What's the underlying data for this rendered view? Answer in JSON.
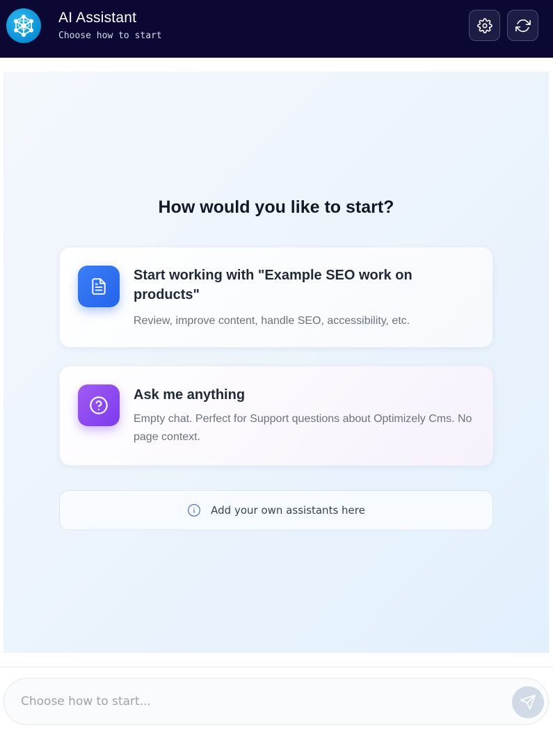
{
  "header": {
    "title": "AI Assistant",
    "subtitle": "Choose how to start",
    "logo_icon": "network-brain-icon",
    "settings_icon": "gear-icon",
    "refresh_icon": "refresh-icon"
  },
  "main": {
    "question": "How would you like to start?",
    "cards": [
      {
        "icon": "document-icon",
        "title": "Start working with \"Example SEO work on products\"",
        "description": "Review, improve content, handle SEO, accessibility, etc."
      },
      {
        "icon": "question-circle-icon",
        "title": "Ask me anything",
        "description": "Empty chat. Perfect for Support questions about Optimizely Cms. No page context."
      }
    ],
    "add_assistants": {
      "icon": "info-icon",
      "label": "Add your own assistants here"
    }
  },
  "composer": {
    "placeholder": "Choose how to start...",
    "send_icon": "send-icon"
  },
  "colors": {
    "header_bg": "#0b0934",
    "accent_blue": "#2563eb",
    "accent_purple": "#7c3aed",
    "logo_blue": "#0a8fd6"
  }
}
